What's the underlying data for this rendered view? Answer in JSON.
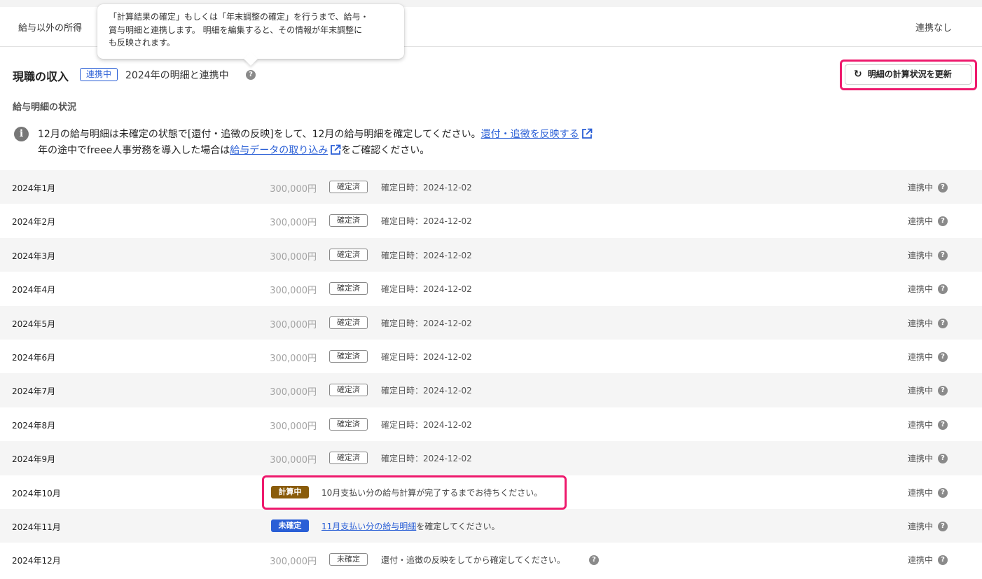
{
  "other_income": {
    "label": "給与以外の所得",
    "status": "連携なし"
  },
  "tooltip": {
    "lines": [
      "「計算結果の確定」もしくは「年末調整の確定」を行うまで、給与・",
      "賞与明細と連携します。 明細を編集すると、その情報が年末調整に",
      "も反映されます。"
    ]
  },
  "header": {
    "title": "現職の収入",
    "badge": "連携中",
    "sync_text": "2024年の明細と連携中",
    "help_glyph": "?",
    "refresh_icon": "↻",
    "refresh_label": "明細の計算状況を更新"
  },
  "sub_title": "給与明細の状況",
  "notice": {
    "icon": "i",
    "line1_text": "12月の給与明細は未確定の状態で[還付・追徴の反映]をして、12月の給与明細を確定してください。",
    "line1_link": "還付・追徴を反映する",
    "line2_text_before": "年の途中でfreee人事労務を導入した場合は",
    "line2_link": "給与データの取り込み",
    "line2_text_after": "をご確認ください。"
  },
  "rows": [
    {
      "month": "2024年1月",
      "amount": "300,000円",
      "tag": "確定済",
      "date": "確定日時：2024-12-02",
      "sync": "連携中"
    },
    {
      "month": "2024年2月",
      "amount": "300,000円",
      "tag": "確定済",
      "date": "確定日時：2024-12-02",
      "sync": "連携中"
    },
    {
      "month": "2024年3月",
      "amount": "300,000円",
      "tag": "確定済",
      "date": "確定日時：2024-12-02",
      "sync": "連携中"
    },
    {
      "month": "2024年4月",
      "amount": "300,000円",
      "tag": "確定済",
      "date": "確定日時：2024-12-02",
      "sync": "連携中"
    },
    {
      "month": "2024年5月",
      "amount": "300,000円",
      "tag": "確定済",
      "date": "確定日時：2024-12-02",
      "sync": "連携中"
    },
    {
      "month": "2024年6月",
      "amount": "300,000円",
      "tag": "確定済",
      "date": "確定日時：2024-12-02",
      "sync": "連携中"
    },
    {
      "month": "2024年7月",
      "amount": "300,000円",
      "tag": "確定済",
      "date": "確定日時：2024-12-02",
      "sync": "連携中"
    },
    {
      "month": "2024年8月",
      "amount": "300,000円",
      "tag": "確定済",
      "date": "確定日時：2024-12-02",
      "sync": "連携中"
    },
    {
      "month": "2024年9月",
      "amount": "300,000円",
      "tag": "確定済",
      "date": "確定日時：2024-12-02",
      "sync": "連携中"
    }
  ],
  "row10": {
    "month": "2024年10月",
    "tag": "計算中",
    "message": "10月支払い分の給与計算が完了するまでお待ちください。",
    "sync": "連携中"
  },
  "row11": {
    "month": "2024年11月",
    "tag": "未確定",
    "link": "11月支払い分の給与明細",
    "message_after": "を確定してください。",
    "sync": "連携中"
  },
  "row12": {
    "month": "2024年12月",
    "amount": "300,000円",
    "tag": "未確定",
    "message": "還付・追徴の反映をしてから確定してください。",
    "sync": "連携中"
  },
  "colors": {
    "highlight": "#ee1a6d",
    "link": "#2a5fd6",
    "calc_tag": "#8a5c0a",
    "unconfirmed_tag": "#2a5fd6"
  }
}
